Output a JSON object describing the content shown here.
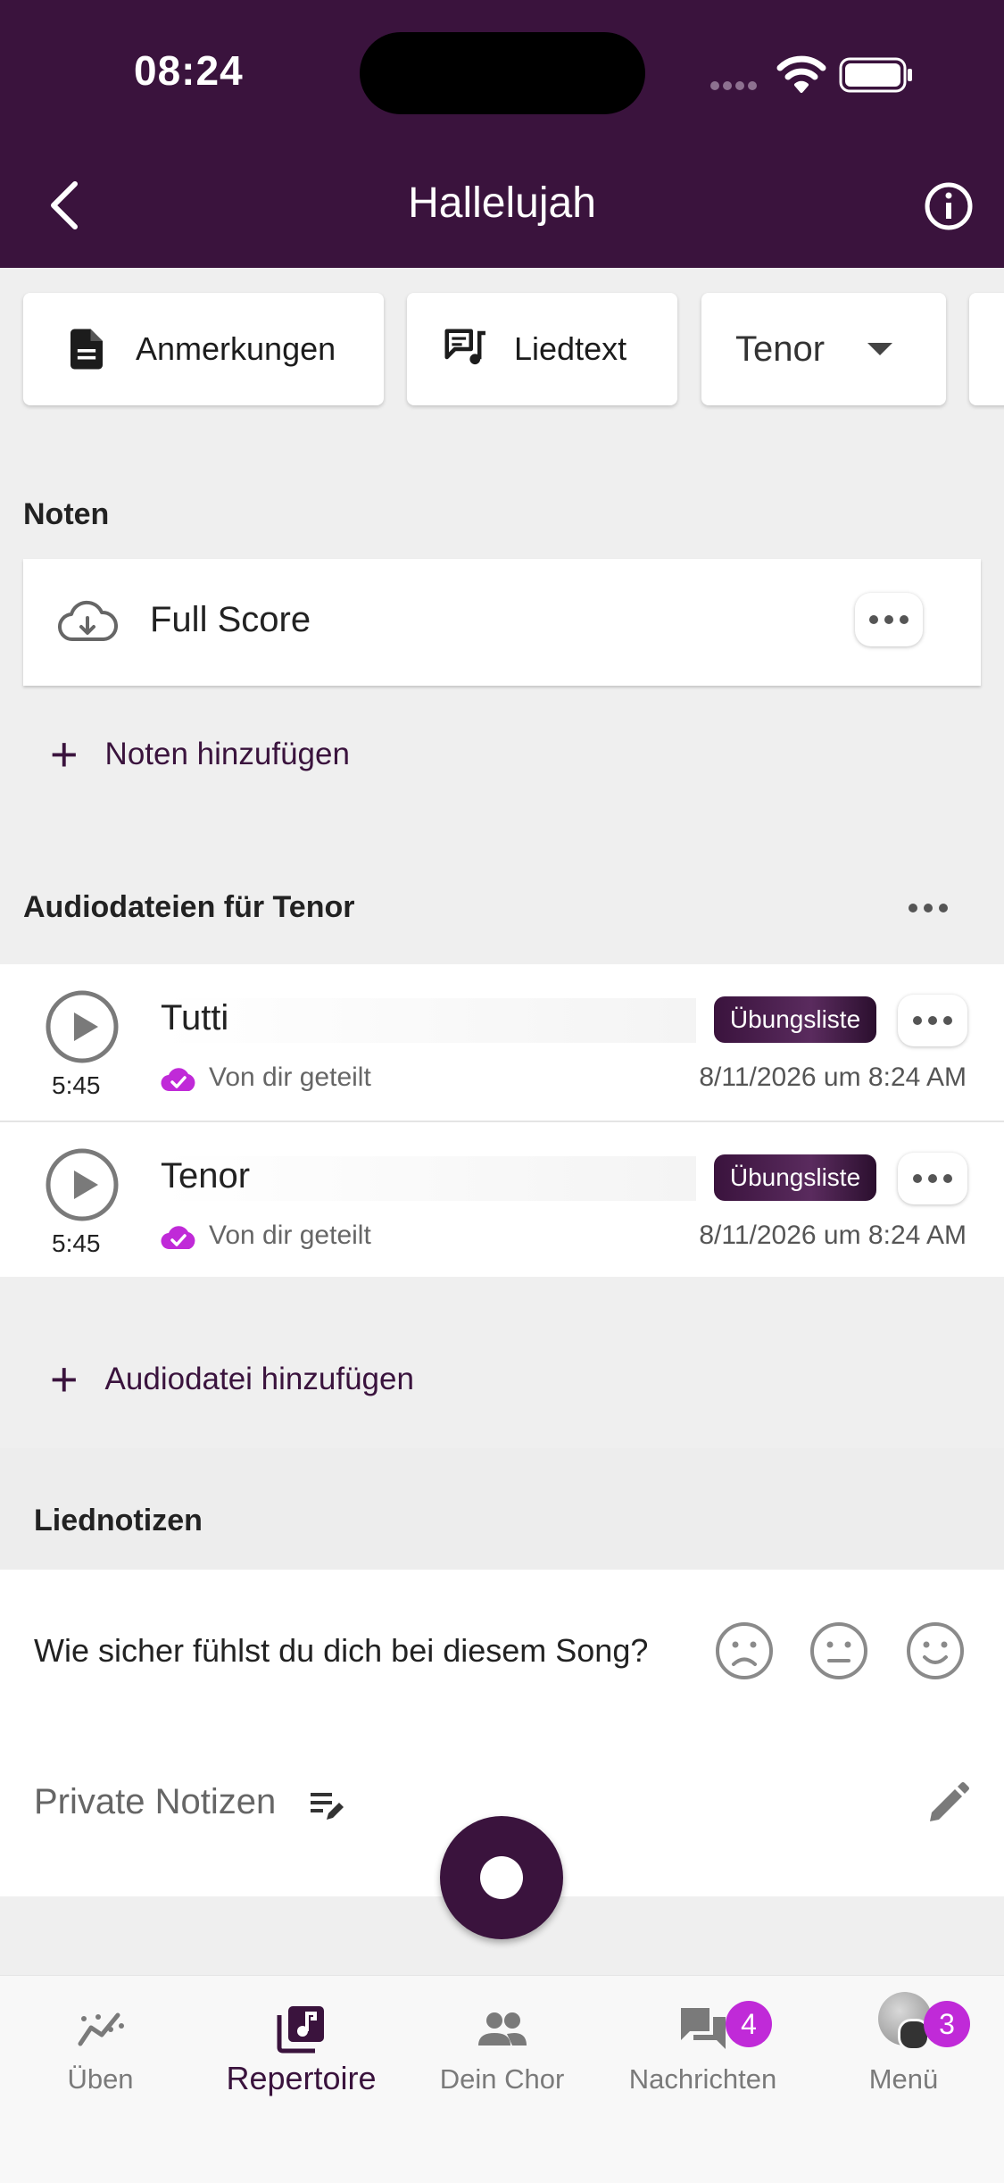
{
  "status_bar": {
    "time": "08:24"
  },
  "header": {
    "title": "Hallelujah"
  },
  "chips": {
    "notes": "Anmerkungen",
    "lyrics": "Liedtext",
    "voice": "Tenor"
  },
  "scores": {
    "title": "Noten",
    "items": [
      {
        "name": "Full Score"
      }
    ],
    "add_label": "Noten hinzufügen"
  },
  "audio": {
    "title": "Audiodateien für Tenor",
    "items": [
      {
        "name": "Tutti",
        "duration": "5:45",
        "badge": "Übungsliste",
        "shared": "Von dir geteilt",
        "date": "8/11/2026 um 8:24 AM"
      },
      {
        "name": "Tenor",
        "duration": "5:45",
        "badge": "Übungsliste",
        "shared": "Von dir geteilt",
        "date": "8/11/2026 um 8:24 AM"
      }
    ],
    "add_label": "Audiodatei hinzufügen"
  },
  "song_notes": {
    "title": "Liednotizen",
    "confidence_question": "Wie sicher fühlst du dich bei diesem Song?",
    "private_notes_label": "Private Notizen"
  },
  "nav": {
    "items": [
      {
        "label": "Üben",
        "icon": "chart-line-icon"
      },
      {
        "label": "Repertoire",
        "icon": "music-library-icon"
      },
      {
        "label": "Dein Chor",
        "icon": "people-icon"
      },
      {
        "label": "Nachrichten",
        "icon": "chat-icon",
        "badge": "4"
      },
      {
        "label": "Menü",
        "icon": "avatar",
        "badge": "3"
      }
    ]
  },
  "colors": {
    "brand": "#3a133d",
    "badge": "#c02ad8",
    "shared_icon": "#c02ad8"
  }
}
